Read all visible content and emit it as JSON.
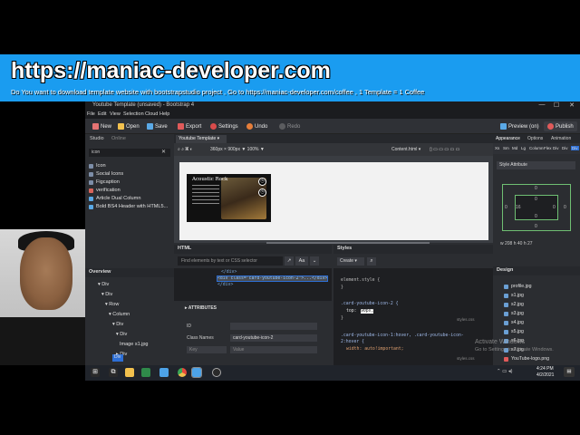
{
  "banner": {
    "url": "https://maniac-developer.com",
    "subtitle": "Do You want to download template website with bootstrapstudio project , Go to https://maniac-developer.com/coffee , 1 Template = 1 Coffee"
  },
  "window": {
    "title": "Youtube Template (unsaved) - Bootstrap 4",
    "min_glyph": "—",
    "max_glyph": "☐",
    "close_glyph": "✕"
  },
  "menu": [
    "File",
    "Edit",
    "View",
    "Selection",
    "Cloud",
    "Help"
  ],
  "toolbar": {
    "new": "New",
    "open": "Open",
    "save": "Save",
    "export": "Export",
    "settings": "Settings",
    "undo": "Undo",
    "redo": "Redo",
    "preview": "Preview (on)",
    "publish": "Publish"
  },
  "left_panel": {
    "tabs": [
      "Studio",
      "Online"
    ],
    "search_value": "icon",
    "search_clear": "✕",
    "components": [
      "Icon",
      "Social Icons",
      "Figcaption",
      "verification",
      "Article Dual Column",
      "Bold BS4 Header with HTML5..."
    ]
  },
  "overview": {
    "title": "Overview",
    "items": [
      {
        "label": "▾ Div"
      },
      {
        "label": "▾ Div"
      },
      {
        "label": "▾ Row"
      },
      {
        "label": "▾ Column"
      },
      {
        "label": "▾ Div"
      },
      {
        "label": "▾ Div"
      },
      {
        "label": "Image  s1.jpg"
      },
      {
        "label": "▸ Div"
      },
      {
        "label": "▸ Div"
      }
    ],
    "selected_label": "Div"
  },
  "canvas": {
    "doc_tab": "Youtube Template ▾",
    "zoom_label": "360px × 900px ▼ 100% ▼",
    "content_html": "Content.html ▾",
    "card_title": "Acoustic Rock",
    "card_icon_1": "◷",
    "card_icon_2": "◷"
  },
  "html_panel": {
    "title": "HTML",
    "search_placeholder": "Find elements by text or CSS selector",
    "arrow": "↗",
    "aa": "Aa",
    "chev": "⌄",
    "code_lines": [
      "</div>",
      "<div class=\"card-youtube-icon-2\">...</div>",
      "</div>"
    ]
  },
  "attributes": {
    "title": "▸ ATTRIBUTES",
    "id_label": "ID",
    "id_value": "",
    "class_label": "Class Names",
    "class_value": "card-youtube-icon-2",
    "key_placeholder": "Key",
    "value_placeholder": "Value"
  },
  "styles_panel": {
    "title": "Styles",
    "create": "Create ▾",
    "search_glyph": "⌕",
    "rule1": "element.style {",
    "rule1_close": "}",
    "rule2_selector": ".card-youtube-icon-2 {",
    "rule2_prop": "top:",
    "rule2_value": "90px;",
    "rule2_close": "}",
    "rule2_file": "styles.css",
    "rule3_selector": ".card-youtube-icon-1:hover, .card-youtube-icon-",
    "rule3_selector_2": "2:hover {",
    "rule3_prop": "width: auto!important;",
    "rule3_file": "styles.css"
  },
  "right_panel": {
    "tabs": [
      "Appearance",
      "Options",
      "Animation"
    ],
    "devices": [
      "Xs",
      "Sm",
      "Md",
      "Lg",
      "Column",
      "Flex",
      "Div",
      "Div",
      "Div"
    ],
    "style_attribute": "Style Attribute",
    "box": {
      "margin_top": "0",
      "margin_left": "0",
      "margin_right": "0",
      "margin_bottom": "0",
      "padding_top": "0",
      "padding_left": "16",
      "padding_right": "0",
      "padding_bottom": "0"
    },
    "size_row": "w 208   h 40   h 27",
    "design_title": "Design",
    "files": [
      "profile.jpg",
      "s1.jpg",
      "s2.jpg",
      "s3.jpg",
      "s4.jpg",
      "s5.jpg",
      "s6.jpg",
      "s7.jpg",
      "YouTube-logo.png"
    ]
  },
  "watermark": {
    "title": "Activate Windows",
    "subtitle": "Go to Settings to activate Windows."
  },
  "taskbar": {
    "time": "4:24 PM",
    "date": "4/2/2021",
    "notif": "▤",
    "tray": "⌃  ▭  ◂)"
  },
  "colors": {
    "banner": "#1a9cf0",
    "app_bg": "#2b2d31",
    "accent_blue": "#2d6fd6",
    "box_model": "#6fbf73",
    "taskbar": "#20242b"
  }
}
